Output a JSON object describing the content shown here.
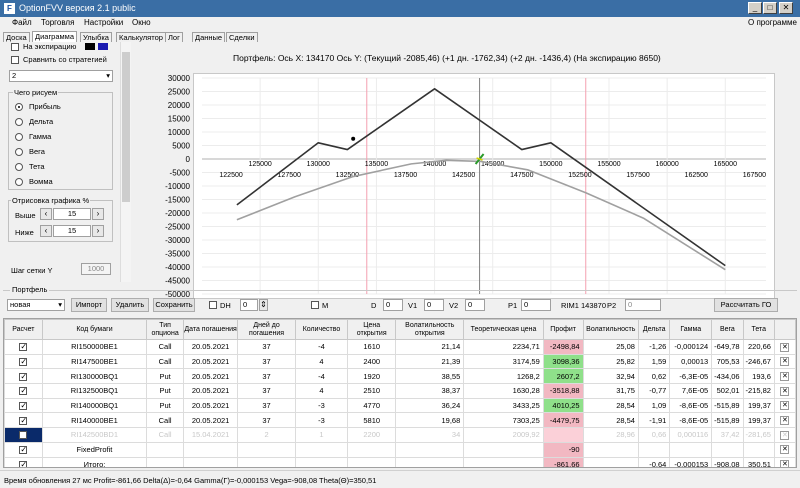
{
  "window": {
    "title": "OptionFVV версия 2.1 public",
    "app_icon": "fv-app-icon"
  },
  "menu": {
    "items": [
      "Файл",
      "Торговля",
      "Настройки",
      "Окно"
    ],
    "about": "О программе"
  },
  "tabs": [
    "Доска",
    "Диаграмма",
    "Улыбка",
    "Калькулятор",
    "Лог",
    "Данные",
    "Сделки"
  ],
  "active_tab": "Диаграмма",
  "left": {
    "expiry_label": "На экспирацию",
    "expiry_colors": [
      "#000000",
      "#1a1ab0"
    ],
    "compare_label": "Сравнить со стратегией",
    "strategy_value": "2",
    "draw_group": "Чего рисуем",
    "draw_options": [
      "Прибыль",
      "Дельта",
      "Гамма",
      "Вега",
      "Тета",
      "Вомма"
    ],
    "draw_selected": 0,
    "range_group": "Отрисовка графика %",
    "above_label": "Выше",
    "above_value": "15",
    "below_label": "Ниже",
    "below_value": "15",
    "grid_step_label": "Шаг сетки Y",
    "grid_step_value": "1000"
  },
  "chart_info": {
    "text": "Портфель: Ось X:  134170  Ось Y:   (Текущий -2085,46)   (+1 дн. -1762,34)   (+2 дн. -1436,4)   (На экспирацию 8650)"
  },
  "chart_data": {
    "type": "line",
    "x_ticks_top": [
      130000,
      135000,
      140000,
      145000,
      150000,
      155000,
      160000,
      165000
    ],
    "x_ticks_bottom": [
      122500,
      127500,
      132500,
      137500,
      142500,
      147500,
      152500,
      157500,
      162500,
      167500
    ],
    "x_ticks_top_offset": [
      125000
    ],
    "xlim": [
      120000,
      168500
    ],
    "ylim": [
      -50000,
      30000
    ],
    "y_ticks": [
      30000,
      25000,
      20000,
      15000,
      10000,
      5000,
      0,
      -5000,
      -10000,
      -15000,
      -20000,
      -25000,
      -30000,
      -35000,
      -40000,
      -45000,
      -50000
    ],
    "cursor_x": 143870,
    "series": [
      {
        "name": "",
        "color": "#333333",
        "x": [
          123000,
          130000,
          132500,
          140000,
          147500,
          150000,
          165000
        ],
        "y": [
          -17000,
          6000,
          3500,
          26000,
          3500,
          6000,
          -39500
        ]
      },
      {
        "name": "",
        "color": "#a0a0a0",
        "x": [
          123000,
          128000,
          133000,
          138000,
          141000,
          144000,
          148000,
          153000,
          158000,
          165000
        ],
        "y": [
          -22500,
          -14000,
          -6500,
          -1800,
          -500,
          -900,
          -4000,
          -12500,
          -22000,
          -41000
        ]
      }
    ],
    "marker_black": {
      "x": 133000,
      "y": 7500
    },
    "marker_green": {
      "x": 143870,
      "y": 0
    },
    "vlines_pink": [
      134170,
      153000
    ]
  },
  "portfolio": {
    "label": "Портфель"
  },
  "toolbar": {
    "portfolio_select": "новая",
    "import": "Импорт",
    "delete": "Удалить",
    "save": "Сохранить",
    "dh_label": "DH",
    "dh_value": "0",
    "m_label": "M",
    "d_label": "D",
    "d_value": "0",
    "v1_label": "V1",
    "v1_value": "0",
    "v2_label": "V2",
    "v2_value": "0",
    "p1_label": "P1",
    "p1_value": "0",
    "rim_label": "RIM1 143870",
    "p2_label": "P2",
    "p2_value": "0",
    "calc_button": "Рассчитать ГО"
  },
  "table": {
    "headers": [
      "Расчет",
      "Код бумаги",
      "Тип опциона",
      "Дата погашения",
      "Дней до погашения",
      "Количество",
      "Цена открытия",
      "Волатильность открытия",
      "Теоретическая цена",
      "Профит",
      "Волатильность",
      "Дельта",
      "Гамма",
      "Вега",
      "Тета",
      ""
    ],
    "rows": [
      {
        "checked": true,
        "code": "RI150000BE1",
        "type": "Call",
        "date": "20.05.2021",
        "days": "37",
        "qty": "-4",
        "price": "1610",
        "vol": "21,14",
        "theo": "2234,71",
        "profit": "-2498,84",
        "pclass": "neg",
        "cvol": "25,08",
        "delta": "-1,26",
        "gamma": "-0,000124",
        "vega": "-649,78",
        "theta": "220,66",
        "faded": false
      },
      {
        "checked": true,
        "code": "RI147500BE1",
        "type": "Call",
        "date": "20.05.2021",
        "days": "37",
        "qty": "4",
        "price": "2400",
        "vol": "21,39",
        "theo": "3174,59",
        "profit": "3098,36",
        "pclass": "pos",
        "cvol": "25,82",
        "delta": "1,59",
        "gamma": "0,00013",
        "vega": "705,53",
        "theta": "-246,67",
        "faded": false
      },
      {
        "checked": true,
        "code": "RI130000BQ1",
        "type": "Put",
        "date": "20.05.2021",
        "days": "37",
        "qty": "-4",
        "price": "1920",
        "vol": "38,55",
        "theo": "1268,2",
        "profit": "2607,2",
        "pclass": "pos",
        "cvol": "32,94",
        "delta": "0,62",
        "gamma": "-6,3E-05",
        "vega": "-434,06",
        "theta": "193,6",
        "faded": false
      },
      {
        "checked": true,
        "code": "RI132500BQ1",
        "type": "Put",
        "date": "20.05.2021",
        "days": "37",
        "qty": "4",
        "price": "2510",
        "vol": "38,37",
        "theo": "1630,28",
        "profit": "-3518,88",
        "pclass": "neg",
        "cvol": "31,75",
        "delta": "-0,77",
        "gamma": "7,6E-05",
        "vega": "502,01",
        "theta": "-215,82",
        "faded": false
      },
      {
        "checked": true,
        "code": "RI140000BQ1",
        "type": "Put",
        "date": "20.05.2021",
        "days": "37",
        "qty": "-3",
        "price": "4770",
        "vol": "36,24",
        "theo": "3433,25",
        "profit": "4010,25",
        "pclass": "pos",
        "cvol": "28,54",
        "delta": "1,09",
        "gamma": "-8,6E-05",
        "vega": "-515,89",
        "theta": "199,37",
        "faded": false
      },
      {
        "checked": true,
        "code": "RI140000BE1",
        "type": "Call",
        "date": "20.05.2021",
        "days": "37",
        "qty": "-3",
        "price": "5810",
        "vol": "19,68",
        "theo": "7303,25",
        "profit": "-4479,75",
        "pclass": "neg",
        "cvol": "28,54",
        "delta": "-1,91",
        "gamma": "-8,6E-05",
        "vega": "-515,89",
        "theta": "199,37",
        "faded": false
      },
      {
        "checked": false,
        "code": "RI142500BD1",
        "type": "Call",
        "date": "15.04.2021",
        "days": "2",
        "qty": "1",
        "price": "2200",
        "vol": "34",
        "theo": "2009,92",
        "profit": "",
        "pclass": "pink",
        "cvol": "28,96",
        "delta": "0,66",
        "gamma": "0,000116",
        "vega": "37,42",
        "theta": "-281,65",
        "faded": true
      }
    ],
    "fixed": {
      "label": "FixedProfit",
      "profit": "-90"
    },
    "total": {
      "label": "Итого:",
      "profit": "-861,66",
      "delta": "-0,64",
      "gamma": "-0,000153",
      "vega": "-908,08",
      "theta": "350,51"
    }
  },
  "status": {
    "text": "Время обновления 27 мс  Profit=-861,66 Delta(Δ)=-0,64 Gamma(Γ)=-0,000153 Vega=-908,08 Theta(Θ)=350,51"
  }
}
